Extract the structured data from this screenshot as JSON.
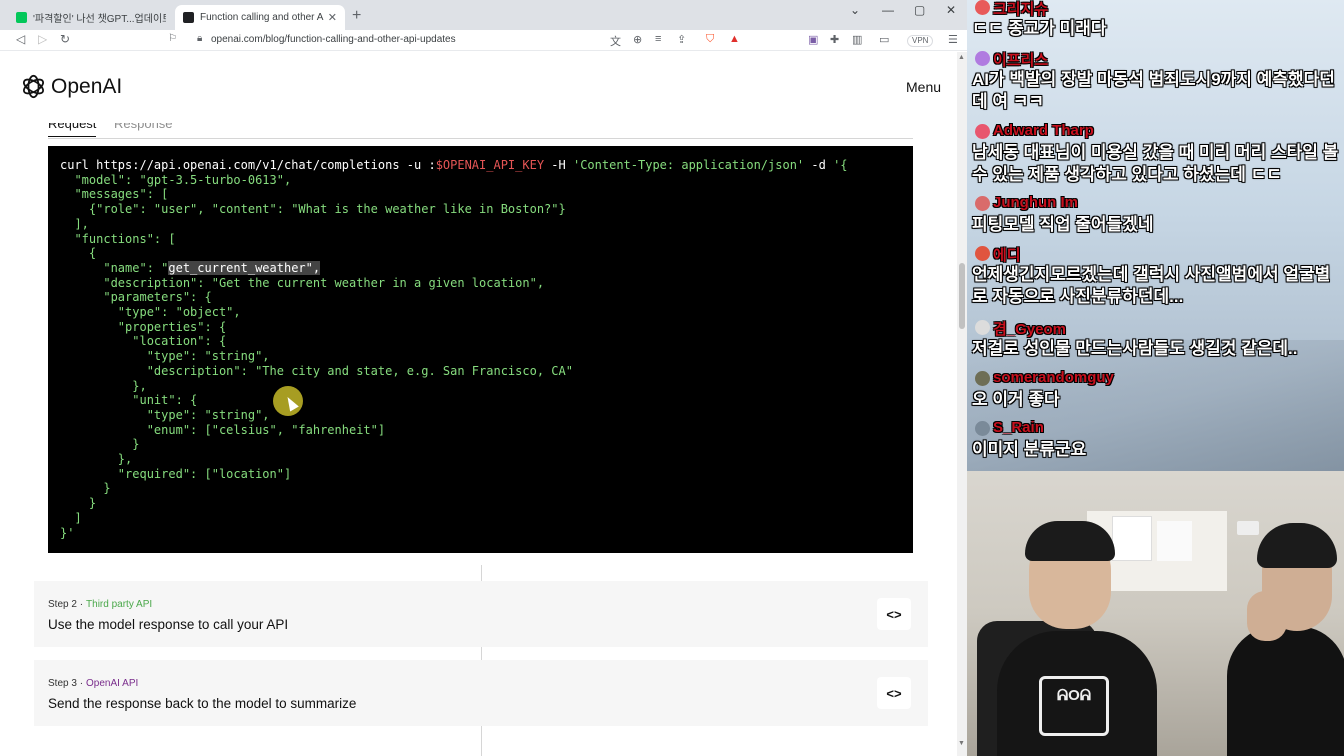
{
  "browser": {
    "tabs": [
      {
        "title": "'파격할인' 나선 챗GPT...업데이트 내용"
      },
      {
        "title": "Function calling and other API u"
      }
    ],
    "url": "openai.com/blog/function-calling-and-other-api-updates",
    "vpn_label": "VPN"
  },
  "page": {
    "logo_text": "OpenAI",
    "menu_label": "Menu",
    "tabs": [
      "Request",
      "Response"
    ],
    "code": {
      "cmd": "curl https://api.openai.com/v1/chat/completions -u :",
      "env_var": "$OPENAI_API_KEY",
      "header_flag": " -H ",
      "header_value": "'Content-Type: application/json'",
      "data_flag": " -d ",
      "body_open": "'{",
      "lines": [
        "  \"model\": \"gpt-3.5-turbo-0613\",",
        "  \"messages\": [",
        "    {\"role\": \"user\", \"content\": \"What is the weather like in Boston?\"}",
        "  ],",
        "  \"functions\": [",
        "    {"
      ],
      "name_prefix": "      \"name\": \"",
      "name_highlight": "get_current_weather\",",
      "lines2": [
        "      \"description\": \"Get the current weather in a given location\",",
        "      \"parameters\": {",
        "        \"type\": \"object\",",
        "        \"properties\": {",
        "          \"location\": {",
        "            \"type\": \"string\",",
        "            \"description\": \"The city and state, e.g. San Francisco, CA\"",
        "          },",
        "          \"unit\": {",
        "            \"type\": \"string\",",
        "            \"enum\": [\"celsius\", \"fahrenheit\"]",
        "          }",
        "        },",
        "        \"required\": [\"location\"]",
        "      }",
        "    }",
        "  ]",
        "}'"
      ]
    },
    "steps": [
      {
        "step": "Step 2 ·",
        "api": "Third party API",
        "api_color": "#4aa84a",
        "title": "Use the model response to call your API",
        "button": "<>"
      },
      {
        "step": "Step 3 ·",
        "api": "OpenAI API",
        "api_color": "#7a2d8c",
        "title": "Send the response back to the model to summarize",
        "button": "<>"
      }
    ]
  },
  "chat": [
    {
      "user": "크리지슈",
      "badge_color": "#e85a5a",
      "text": "ㄷㄷ 종교가 미래다"
    },
    {
      "user": "이프리스",
      "badge_color": "#b07be0",
      "text": "AI가 백발의 장발 마동석 범죄도시9까지 예측했다던데 여 ㅋㅋ"
    },
    {
      "user": "Adward Tharp",
      "badge_color": "#e8566e",
      "text": "남세동 대표님이 미용실 갔을 때 미리 머리 스타일 볼 수 있는 제품 생각하고 있다고 하셨는데 ㄷㄷ"
    },
    {
      "user": "Junghun Im",
      "badge_color": "#d96b6b",
      "text": "피팅모델 직업 줄어들겠네"
    },
    {
      "user": "에디",
      "badge_color": "#e0553f",
      "text": "언제생긴지모르겠는데 갤럭시 사진앨범에서 얼굴별로 자동으로 사진분류하던데..."
    },
    {
      "user": "겸_Gyeom",
      "badge_color": "#dcdcdc",
      "text": "저걸로 성인물 만드는사람들도 생길것 같은데.."
    },
    {
      "user": "somerandomguy",
      "badge_color": "#6e6e55",
      "text": "오 이거 좋다"
    },
    {
      "user": "S_Rain",
      "badge_color": "#7a8a99",
      "text": "이미지 분류군요"
    }
  ],
  "webcam": {
    "shirt_text": "ᕱOᕱ"
  }
}
